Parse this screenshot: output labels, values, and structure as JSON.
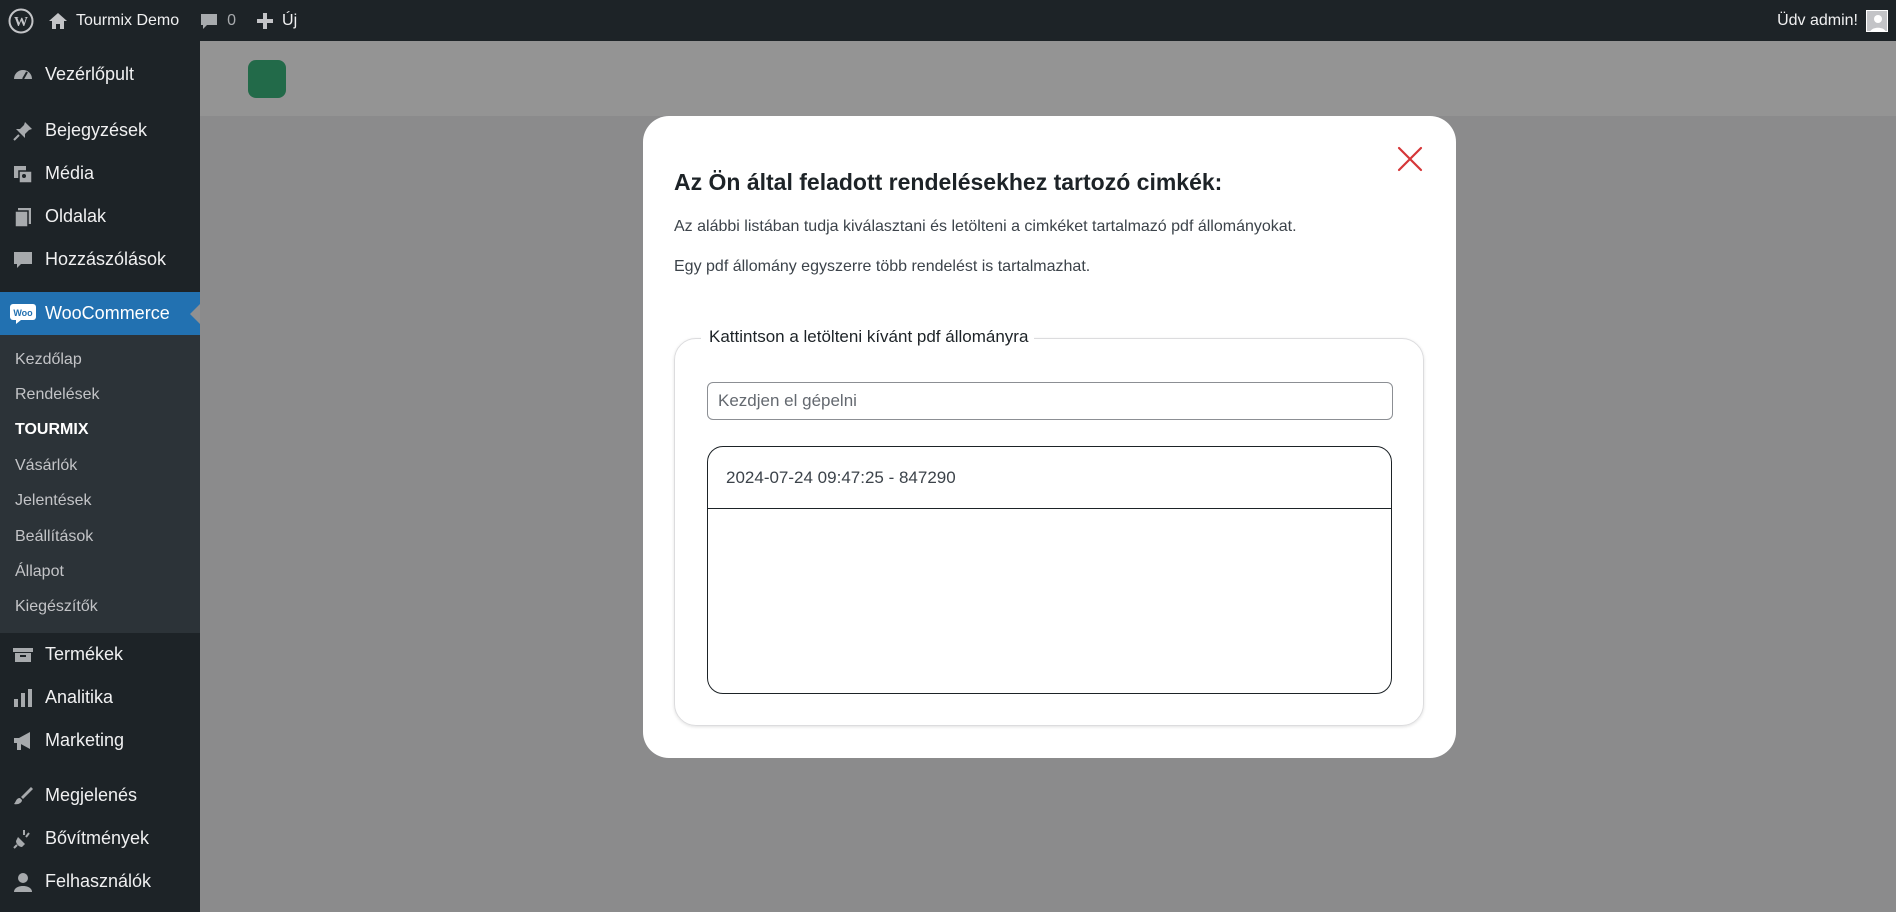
{
  "adminbar": {
    "site_name": "Tourmix Demo",
    "comments_count": "0",
    "new_label": "Új",
    "greeting": "Üdv admin!"
  },
  "sidebar": {
    "items_top": [
      {
        "label": "Vezérlőpult",
        "icon": "dashboard-icon"
      }
    ],
    "items_content": [
      {
        "label": "Bejegyzések",
        "icon": "pin-icon"
      },
      {
        "label": "Média",
        "icon": "media-icon"
      },
      {
        "label": "Oldalak",
        "icon": "page-icon"
      },
      {
        "label": "Hozzászólások",
        "icon": "comment-icon"
      }
    ],
    "woocommerce": {
      "label": "WooCommerce",
      "icon": "woocommerce-icon"
    },
    "submenu": [
      "Kezdőlap",
      "Rendelések",
      "TOURMIX",
      "Vásárlók",
      "Jelentések",
      "Beállítások",
      "Állapot",
      "Kiegészítők"
    ],
    "items_shop": [
      {
        "label": "Termékek",
        "icon": "archive-icon"
      },
      {
        "label": "Analitika",
        "icon": "chart-icon"
      },
      {
        "label": "Marketing",
        "icon": "megaphone-icon"
      }
    ],
    "items_admin": [
      {
        "label": "Megjelenés",
        "icon": "brush-icon"
      },
      {
        "label": "Bővítmények",
        "icon": "plugin-icon"
      },
      {
        "label": "Felhasználók",
        "icon": "user-icon"
      }
    ]
  },
  "modal": {
    "title": "Az Ön által feladott rendelésekhez tartozó cimkék:",
    "paragraph1": "Az alábbi listában tudja kiválasztani és letölteni a cimkéket tartalmazó pdf állományokat.",
    "paragraph2": "Egy pdf állomány egyszerre több rendelést is tartalmazhat.",
    "legend": "Kattintson a letölteni kívánt pdf állományra",
    "search_placeholder": "Kezdjen el gépelni",
    "search_value": "",
    "list_items": [
      "2024-07-24 09:47:25 - 847290"
    ]
  },
  "colors": {
    "admin_dark": "#1d2327",
    "accent": "#2271b1",
    "close_red": "#d63638",
    "brand_green": "#3bb77e"
  }
}
